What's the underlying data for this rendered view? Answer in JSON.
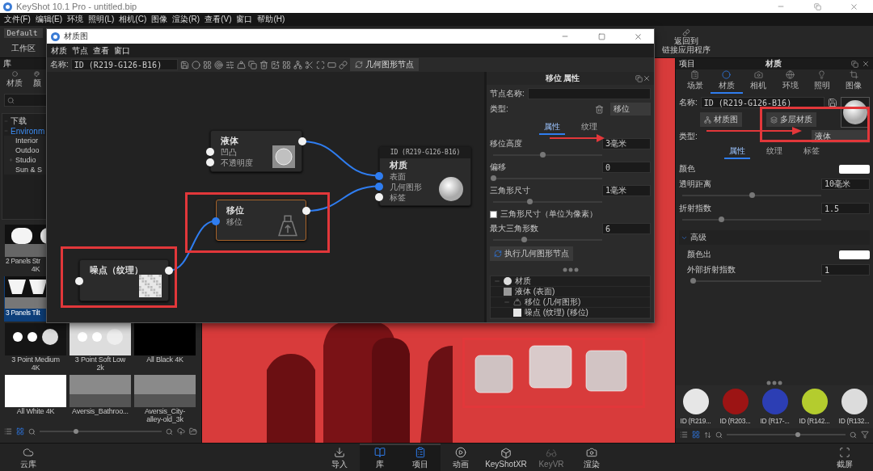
{
  "app": {
    "title": "KeyShot 10.1 Pro  - untitled.bip"
  },
  "menu": [
    "文件(F)",
    "编辑(E)",
    "环境",
    "照明(L)",
    "相机(C)",
    "图像",
    "渲染(R)",
    "查看(V)",
    "窗口",
    "帮助(H)"
  ],
  "workspace": {
    "preset": "Default",
    "label": "工作区"
  },
  "return_button": {
    "lines": [
      "返回到",
      "链接应用程序"
    ]
  },
  "library": {
    "title": "库",
    "tabs": [
      {
        "label": "材质",
        "kind": "material"
      },
      {
        "label": "颜",
        "kind": "color"
      }
    ],
    "tree": [
      {
        "label": "下载",
        "selected": false,
        "expanded": true
      },
      {
        "label": "Environm",
        "selected": true,
        "expanded": true,
        "children": [
          {
            "label": "Interior",
            "selected": false
          },
          {
            "label": "Outdoo",
            "selected": false
          },
          {
            "label": "Studio",
            "selected": false,
            "expanded": false
          },
          {
            "label": "Sun & S",
            "selected": false
          }
        ]
      }
    ],
    "zoom": {
      "level": 0.3
    },
    "thumbnail_rows": [
      [
        {
          "lines": [
            "2 Panels Str",
            "4K"
          ],
          "kind": "panels2",
          "selected": false
        }
      ],
      [
        {
          "lines": [
            "3 Panels Tilt"
          ],
          "kind": "panels3",
          "selected": true
        }
      ],
      [
        {
          "lines": [
            "3 Point Medium",
            "4K"
          ],
          "kind": "points",
          "selected": false
        },
        {
          "lines": [
            "3 Point Soft Low",
            "2k"
          ],
          "kind": "soft",
          "selected": false
        },
        {
          "lines": [
            "All Black 4K"
          ],
          "kind": "black",
          "selected": false
        }
      ],
      [
        {
          "lines": [
            "All White 4K"
          ],
          "kind": "white",
          "selected": false
        },
        {
          "lines": [
            "Aversis_Bathroo..."
          ],
          "kind": "photo",
          "selected": false
        },
        {
          "lines": [
            "Aversis_City-",
            "alley-old_3k"
          ],
          "kind": "photo",
          "selected": false
        }
      ]
    ]
  },
  "graph_window": {
    "title": "材质图",
    "menu": [
      "材质",
      "节点",
      "查看",
      "窗口"
    ],
    "name_label": "名称:",
    "name_value": "ID (R219-G126-B16)",
    "node_button": "几何图形节点",
    "nodes": [
      {
        "kind": "liquid",
        "title": "液体",
        "selected": false,
        "highlighted": false,
        "inputs": [
          {
            "label": "凹凸",
            "connected": false
          },
          {
            "label": "不透明度",
            "connected": false
          }
        ]
      },
      {
        "kind": "displacement",
        "title": "移位",
        "selected": true,
        "highlighted": true,
        "inputs": [
          {
            "label": "移位",
            "connected": true
          }
        ]
      },
      {
        "kind": "noise",
        "title": "噪点（纹理）",
        "selected": false,
        "highlighted": true,
        "inputs": [
          {
            "connected": false
          }
        ]
      },
      {
        "kind": "material",
        "header": "ID (R219-G126-B16)",
        "title": "材质",
        "selected": false,
        "highlighted": false,
        "inputs": [
          {
            "label": "表面",
            "connected": true
          },
          {
            "label": "几何图形",
            "connected": true
          },
          {
            "label": "标签",
            "connected": false
          }
        ]
      }
    ]
  },
  "props_panel": {
    "title": "移位  属性",
    "node_name_label": "节点名称:",
    "type_label": "类型:",
    "type_value": "移位",
    "tabs": [
      {
        "label": "属性",
        "selected": true
      },
      {
        "label": "纹理",
        "selected": false
      }
    ],
    "fields": [
      {
        "kind": "slider",
        "label": "移位高度",
        "value": "3毫米",
        "level": 0.45
      },
      {
        "kind": "slider",
        "label": "偏移",
        "value": "0",
        "level": 0
      },
      {
        "kind": "slider",
        "label": "三角形尺寸",
        "value": "1毫米",
        "level": 0.33
      },
      {
        "kind": "checkbox",
        "label": "三角形尺寸（单位为像素）",
        "checked": false
      },
      {
        "kind": "slider",
        "label": "最大三角形数",
        "value": "6",
        "level": 0.28
      }
    ],
    "run_button": "执行几何图形节点",
    "tree": [
      {
        "label": "材质",
        "kind": "material",
        "expanded": true,
        "children": [
          {
            "label": "液体 (表面)",
            "kind": "liquid"
          },
          {
            "label": "移位 (几何图形)",
            "kind": "displacement",
            "expanded": true,
            "children": [
              {
                "label": "噪点 (纹理) (移位)",
                "kind": "noise"
              }
            ]
          }
        ]
      }
    ]
  },
  "project_panel": {
    "title": "项目",
    "section": "材质",
    "tabs": [
      {
        "label": "场景",
        "kind": "scene",
        "selected": false
      },
      {
        "label": "材质",
        "kind": "material",
        "selected": true
      },
      {
        "label": "相机",
        "kind": "camera",
        "selected": false
      },
      {
        "label": "环境",
        "kind": "environment",
        "selected": false
      },
      {
        "label": "照明",
        "kind": "lighting",
        "selected": false
      },
      {
        "label": "图像",
        "kind": "image",
        "selected": false
      }
    ],
    "name_label": "名称:",
    "name_value": "ID (R219-G126-B16)",
    "buttons": [
      "材质图",
      "多层材质"
    ],
    "type_label": "类型:",
    "type_value": "液体",
    "subtabs": [
      {
        "label": "属性",
        "selected": true
      },
      {
        "label": "纹理",
        "selected": false
      },
      {
        "label": "标签",
        "selected": false
      }
    ],
    "properties": [
      {
        "kind": "color",
        "label": "颜色"
      },
      {
        "kind": "slider",
        "label": "透明距离",
        "value": "10毫米",
        "level": 0.5
      },
      {
        "kind": "slider",
        "label": "折射指数",
        "value": "1.5",
        "level": 0.28
      }
    ],
    "zoom": {
      "level": 0.6
    },
    "advanced": {
      "label": "高级",
      "expanded": true,
      "properties": [
        {
          "kind": "color",
          "label": "颜色出"
        },
        {
          "kind": "slider",
          "label": "外部折射指数",
          "value": "1",
          "level": 0.02
        }
      ]
    },
    "materials": [
      {
        "label": "ID (R219...",
        "color": "#e6e6e6"
      },
      {
        "label": "ID (R203...",
        "color": "#9c1414"
      },
      {
        "label": "ID (R17-...",
        "color": "#2c3eb4"
      },
      {
        "label": "ID (R142...",
        "color": "#b4cc2e"
      },
      {
        "label": "ID (R132...",
        "color": "#dcdcdc"
      }
    ]
  },
  "dock": {
    "left": "云库",
    "right": "截屏",
    "tools": [
      {
        "label": "导入",
        "kind": "import",
        "selected": false,
        "disabled": false
      },
      {
        "label": "库",
        "kind": "library",
        "selected": true,
        "disabled": false
      },
      {
        "label": "项目",
        "kind": "project",
        "selected": true,
        "disabled": false
      },
      {
        "label": "动画",
        "kind": "animation",
        "selected": false,
        "disabled": false
      },
      {
        "label": "KeyShotXR",
        "kind": "xr",
        "selected": false,
        "disabled": false
      },
      {
        "label": "KeyVR",
        "kind": "vr",
        "selected": false,
        "disabled": true
      },
      {
        "label": "渲染",
        "kind": "render",
        "selected": false,
        "disabled": false
      }
    ]
  }
}
